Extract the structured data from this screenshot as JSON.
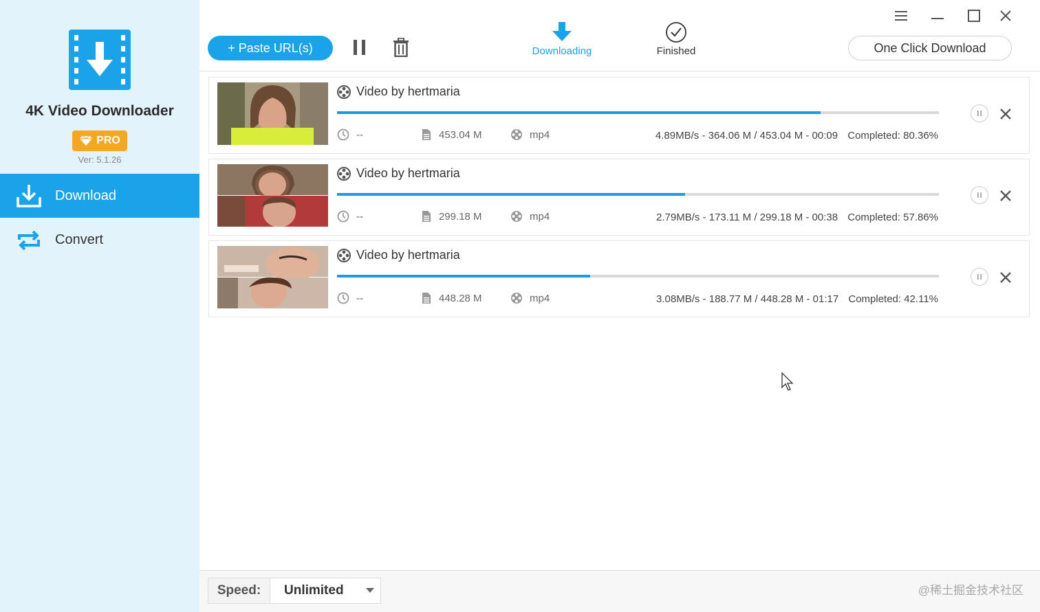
{
  "app": {
    "name": "4K Video Downloader",
    "badge": "PRO",
    "version": "Ver: 5.1.26",
    "accent_color": "#1aa3e8",
    "badge_color": "#f5a623"
  },
  "sidebar": {
    "items": [
      {
        "label": "Download",
        "icon": "download-tray-icon",
        "active": true
      },
      {
        "label": "Convert",
        "icon": "convert-arrows-icon",
        "active": false
      }
    ]
  },
  "toolbar": {
    "paste_label": "+ Paste URL(s)",
    "pause_all_icon": "pause-icon",
    "delete_icon": "trash-icon",
    "tabs": [
      {
        "label": "Downloading",
        "icon": "download-arrow-icon",
        "active": true
      },
      {
        "label": "Finished",
        "icon": "check-circle-icon",
        "active": false
      }
    ],
    "one_click_label": "One Click Download"
  },
  "window_controls": [
    "menu-icon",
    "minimize-icon",
    "maximize-icon",
    "close-icon"
  ],
  "downloads": [
    {
      "title": "Video by hertmaria",
      "progress": 0.8036,
      "duration": "--",
      "size": "453.04 M",
      "format": "mp4",
      "stats": "4.89MB/s - 364.06 M / 453.04 M - 00:09",
      "completed": "Completed:  80.36%"
    },
    {
      "title": "Video by hertmaria",
      "progress": 0.5786,
      "duration": "--",
      "size": "299.18 M",
      "format": "mp4",
      "stats": "2.79MB/s - 173.11 M / 299.18 M - 00:38",
      "completed": "Completed:  57.86%"
    },
    {
      "title": "Video by hertmaria",
      "progress": 0.4211,
      "duration": "--",
      "size": "448.28 M",
      "format": "mp4",
      "stats": "3.08MB/s - 188.77 M / 448.28 M - 01:17",
      "completed": "Completed:  42.11%"
    }
  ],
  "footer": {
    "speed_label": "Speed:",
    "speed_value": "Unlimited",
    "watermark": "@稀土掘金技术社区"
  }
}
